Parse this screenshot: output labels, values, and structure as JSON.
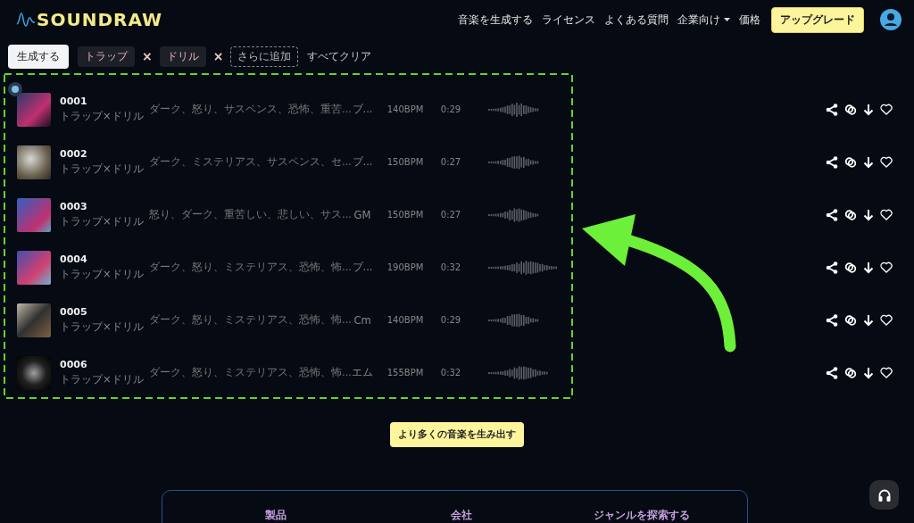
{
  "header": {
    "logo": "SOUNDRAW",
    "nav": [
      {
        "label": "音楽を生成する",
        "dropdown": false
      },
      {
        "label": "ライセンス",
        "dropdown": false
      },
      {
        "label": "よくある質問",
        "dropdown": false
      },
      {
        "label": "企業向け",
        "dropdown": true
      },
      {
        "label": "価格",
        "dropdown": false
      }
    ],
    "upgrade": "アップグレード"
  },
  "filters": {
    "generate": "生成する",
    "chips": [
      {
        "label": "トラップ",
        "remove": "×"
      },
      {
        "label": "ドリル",
        "remove": "×"
      }
    ],
    "add": "さらに追加",
    "clear": "すべてクリア"
  },
  "tracks": [
    {
      "number": "0001",
      "genre": "トラップ×ドリル",
      "moods": "ダーク、怒り、サスペンス、恐怖、重苦...",
      "key": "ブ...",
      "bpm": "140BPM",
      "length": "0:29",
      "playing": true
    },
    {
      "number": "0002",
      "genre": "トラップ×ドリル",
      "moods": "ダーク、ミステリアス、サスペンス、セ...",
      "key": "ブ...",
      "bpm": "150BPM",
      "length": "0:27",
      "playing": false
    },
    {
      "number": "0003",
      "genre": "トラップ×ドリル",
      "moods": "怒り、ダーク、重苦しい、悲しい、サス...",
      "key": "GM",
      "bpm": "150BPM",
      "length": "0:27",
      "playing": false
    },
    {
      "number": "0004",
      "genre": "トラップ×ドリル",
      "moods": "ダーク、怒り、ミステリアス、恐怖、怖...",
      "key": "ブ...",
      "bpm": "190BPM",
      "length": "0:32",
      "playing": false
    },
    {
      "number": "0005",
      "genre": "トラップ×ドリル",
      "moods": "ダーク、怒り、ミステリアス、恐怖、怖...",
      "key": "Cm",
      "bpm": "140BPM",
      "length": "0:29",
      "playing": false
    },
    {
      "number": "0006",
      "genre": "トラップ×ドリル",
      "moods": "ダーク、怒り、ミステリアス、恐怖、怖...",
      "key": "エム",
      "bpm": "155BPM",
      "length": "0:32",
      "playing": false
    }
  ],
  "load_more": "より多くの音楽を生み出す",
  "footer": {
    "columns": [
      "製品",
      "会社",
      "ジャンルを探索する"
    ]
  }
}
